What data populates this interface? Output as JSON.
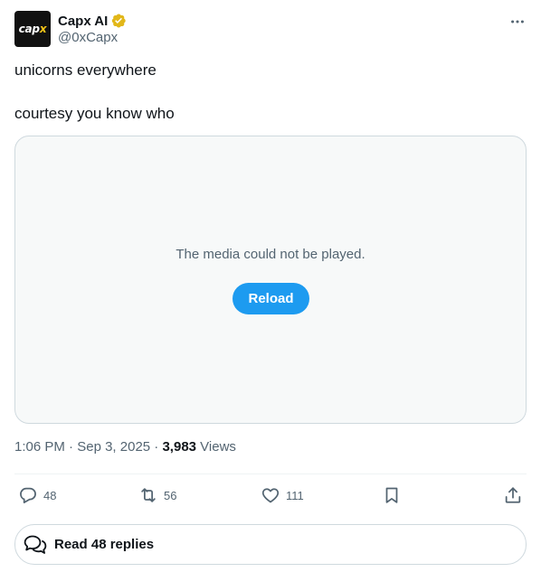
{
  "author": {
    "display_name": "Capx AI",
    "handle": "@0xCapx",
    "avatar_text_main": "cap",
    "avatar_text_accent": "x",
    "verified_icon": "verified-badge-gold",
    "more_icon": "ellipsis-icon"
  },
  "tweet": {
    "lines": [
      "unicorns everywhere",
      "courtesy you know who"
    ]
  },
  "media": {
    "message": "The media could not be played.",
    "reload_label": "Reload"
  },
  "meta": {
    "time": "1:06 PM",
    "separator1": " · ",
    "date": "Sep 3, 2025",
    "separator2": " · ",
    "views_count": "3,983",
    "views_label": " Views"
  },
  "actions": {
    "replies": "48",
    "reposts": "56",
    "likes": "111"
  },
  "read_replies": {
    "label": "Read 48 replies"
  },
  "colors": {
    "accent": "#1d9bf0",
    "verified": "#e2b719",
    "text": "#0f1419",
    "muted": "#536471",
    "border": "#cfd9de"
  }
}
